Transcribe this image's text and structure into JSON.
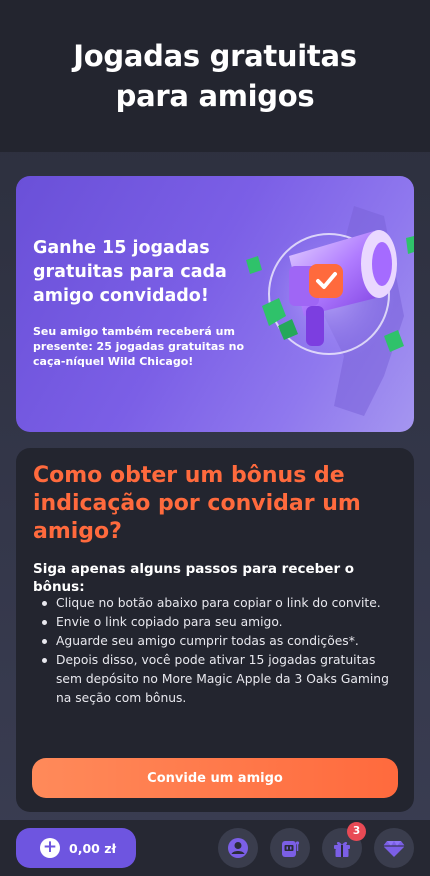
{
  "header": {
    "title": "Jogadas gratuitas para amigos"
  },
  "promo": {
    "title": "Ganhe 15 jogadas gratuitas para cada amigo convidado!",
    "subtitle": "Seu amigo também receberá um presente: 25 jogadas gratuitas no caça-níquel Wild Chicago!"
  },
  "info": {
    "heading": "Como obter um bônus de indicação por convidar um amigo?",
    "lead": "Siga apenas alguns passos para receber o bônus:",
    "steps": [
      "Clique no botão abaixo para copiar o link do convite.",
      "Envie o link copiado para seu amigo.",
      "Aguarde seu amigo cumprir todas as condições*.",
      "Depois disso, você pode ativar 15 jogadas gratuitas sem depósito no More Magic Apple da 3 Oaks Gaming na seção com bônus."
    ],
    "cta_label": "Convide um amigo"
  },
  "bottombar": {
    "balance": "0,00 zł",
    "plus_icon": "plus-icon",
    "gift_badge": "3",
    "nav_icons": [
      "user-icon",
      "slot-machine-icon",
      "gift-icon",
      "diamond-icon"
    ]
  },
  "colors": {
    "accent_orange": "#ff6a3d",
    "accent_purple": "#6e55e0",
    "badge_red": "#e84a55",
    "card_bg": "#23252f"
  }
}
